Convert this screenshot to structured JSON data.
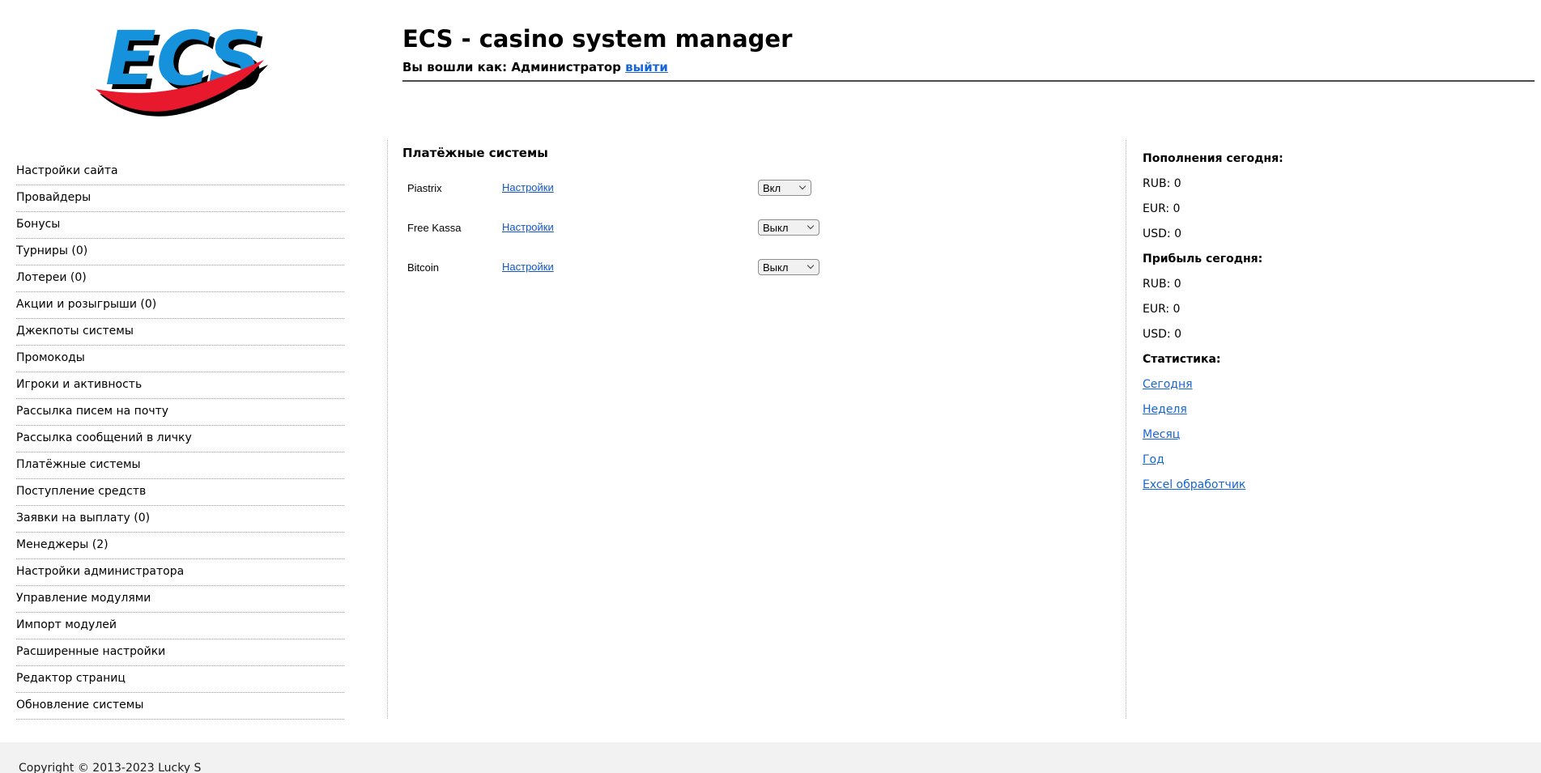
{
  "header": {
    "logo_text": "ECS",
    "title": "ECS - casino system manager",
    "login_prefix": "Вы вошли как: Администратор",
    "logout_link": "выйти"
  },
  "sidebar": {
    "items": [
      {
        "label": "Настройки сайта"
      },
      {
        "label": "Провайдеры"
      },
      {
        "label": "Бонусы"
      },
      {
        "label": "Турниры (0)"
      },
      {
        "label": "Лотереи (0)"
      },
      {
        "label": "Акции и розыгрыши (0)"
      },
      {
        "label": "Джекпоты системы"
      },
      {
        "label": "Промокоды"
      },
      {
        "label": "Игроки и активность"
      },
      {
        "label": "Рассылка писем на почту"
      },
      {
        "label": "Рассылка сообщений в личку"
      },
      {
        "label": "Платёжные системы"
      },
      {
        "label": "Поступление средств"
      },
      {
        "label": "Заявки на выплату (0)"
      },
      {
        "label": "Менеджеры (2)"
      },
      {
        "label": "Настройки администратора"
      },
      {
        "label": "Управление модулями"
      },
      {
        "label": "Импорт модулей"
      },
      {
        "label": "Расширенные настройки"
      },
      {
        "label": "Редактор страниц"
      },
      {
        "label": "Обновление системы"
      }
    ]
  },
  "main": {
    "heading": "Платёжные системы",
    "settings_link_label": "Настройки",
    "payment_systems": [
      {
        "name": "Piastrix",
        "state": "Вкл"
      },
      {
        "name": "Free Kassa",
        "state": "Выкл"
      },
      {
        "name": "Bitcoin",
        "state": "Выкл"
      }
    ]
  },
  "stats_panel": {
    "deposits_header": "Пополнения сегодня:",
    "deposits": [
      "RUB: 0",
      "EUR: 0",
      "USD: 0"
    ],
    "profit_header": "Прибыль сегодня:",
    "profit": [
      "RUB: 0",
      "EUR: 0",
      "USD: 0"
    ],
    "stats_header": "Статистика:",
    "links": [
      "Сегодня",
      "Неделя",
      "Месяц",
      "Год",
      "Excel обработчик"
    ]
  },
  "footer": {
    "copyright": "Copyright © 2013-2023 Lucky S"
  },
  "colors": {
    "logo_blue": "#1691DC",
    "logo_red": "#E8192C",
    "link_blue": "#1155CC",
    "accent_link_blue": "#1766D6",
    "footer_bg": "#F2F2F2",
    "rule_gray": "#4A4A4A"
  }
}
